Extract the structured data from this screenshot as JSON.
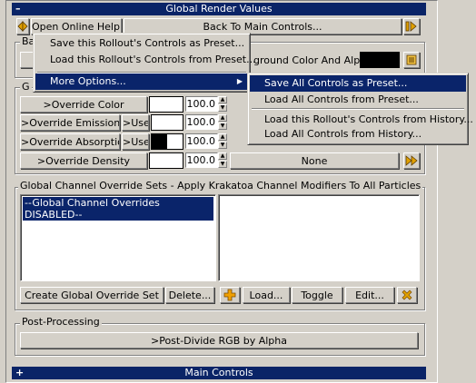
{
  "window": {
    "title": "Global Render Values",
    "title_sign": "–",
    "footer_title": "Main Controls",
    "footer_sign": "+"
  },
  "toolbar": {
    "open_help_label": "Open Online Help...",
    "back_label": "Back To Main Controls..."
  },
  "background": {
    "color_label": "ground Color And Alpha:",
    "swatch_color": "#000000"
  },
  "overrides": [
    {
      "label": ">Override Color",
      "use_label": "",
      "swatch": "#ffffff",
      "value": "100.0"
    },
    {
      "label": ">Override Emission",
      "use_label": ">Use",
      "swatch": "#ffffff",
      "value": "100.0"
    },
    {
      "label": ">Override Absorption",
      "use_label": ">Use",
      "swatch": "#000000",
      "value": "100.0"
    },
    {
      "label": ">Override Density",
      "use_label": "",
      "swatch": "#ffffff",
      "value": "100.0"
    }
  ],
  "density_map_label": "None",
  "channel_sets": {
    "group_label": "Global Channel Override Sets - Apply Krakatoa Channel Modifiers To All Particles",
    "selected_item": "--Global Channel Overrides DISABLED--",
    "buttons": {
      "create": "Create Global Override Set",
      "delete": "Delete...",
      "load": "Load...",
      "toggle": "Toggle",
      "edit": "Edit..."
    }
  },
  "post_processing": {
    "group_label": "Post-Processing",
    "button_label": ">Post-Divide RGB by Alpha"
  },
  "context_menu": {
    "items": [
      "Save this Rollout's Controls as Preset...",
      "Load this Rollout's Controls from Preset...",
      "More Options..."
    ]
  },
  "submenu": {
    "items": [
      "Save All Controls as Preset...",
      "Load All Controls from Preset...",
      "Load this Rollout's Controls from History...",
      "Load All Controls from History..."
    ]
  },
  "colors": {
    "title_bg": "#0a2467",
    "highlight": "#0a246a",
    "panel": "#d4d0c8",
    "add_icon": "#f0a000",
    "delete_icon": "#e0a000"
  }
}
